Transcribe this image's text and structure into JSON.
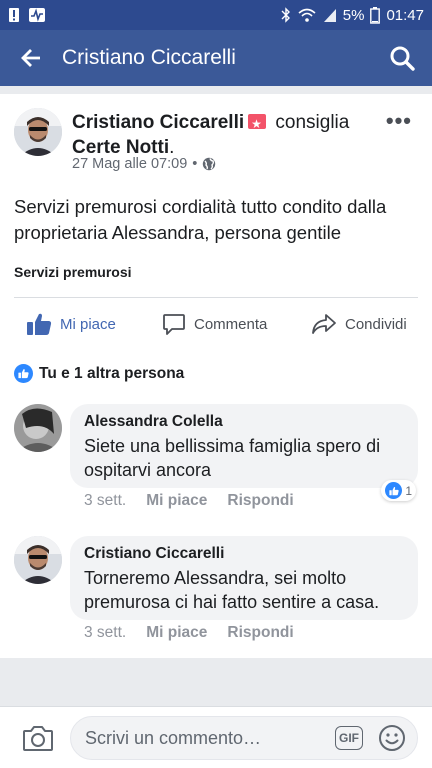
{
  "status_bar": {
    "battery_text": "5%",
    "time": "01:47",
    "left_icons": [
      "alert-icon",
      "activity-icon"
    ],
    "right_icons": [
      "bluetooth-icon",
      "wifi-icon",
      "signal-icon",
      "battery-icon"
    ]
  },
  "app_bar": {
    "title": "Cristiano Ciccarelli",
    "back_icon": "arrow-left-icon",
    "search_icon": "search-icon",
    "color": "#3b5998"
  },
  "post": {
    "author": "Cristiano Ciccarelli",
    "verb": "consiglia",
    "page_name": "Certe Notti",
    "page_suffix": ".",
    "timestamp": "27 Mag alle 07:09",
    "dot": "•",
    "privacy_icon": "globe-icon",
    "more_label": "•••",
    "text": "Servizi premurosi cordialità tutto condito dalla proprietaria Alessandra,  persona gentile",
    "tag": "Servizi premurosi",
    "actions": {
      "like": "Mi piace",
      "comment": "Commenta",
      "share": "Condividi"
    },
    "reactions_text": "Tu e 1 altra persona"
  },
  "comments": [
    {
      "author": "Alessandra Colella",
      "text": "Siete una bellissima famiglia  spero di ospitarvi ancora",
      "time": "3 sett.",
      "like_label": "Mi piace",
      "reply_label": "Rispondi",
      "like_count": "1"
    },
    {
      "author": "Cristiano Ciccarelli",
      "text": "Torneremo Alessandra, sei molto premurosa ci hai fatto sentire a casa.",
      "time": "3 sett.",
      "like_label": "Mi piace",
      "reply_label": "Rispondi"
    }
  ],
  "composer": {
    "placeholder": "Scrivi un commento…",
    "gif_label": "GIF"
  }
}
